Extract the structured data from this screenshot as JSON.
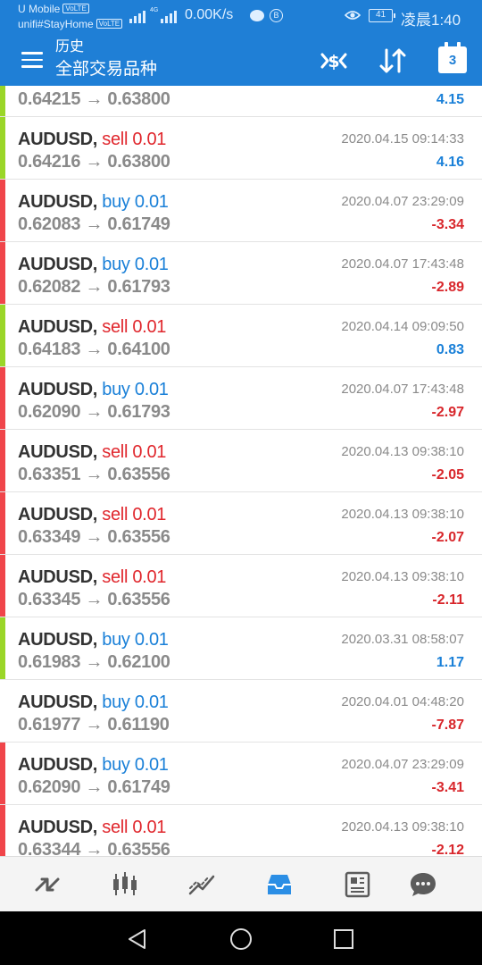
{
  "status_bar": {
    "carrier_1": "U Mobile",
    "carrier_2": "unifi#StayHome",
    "volte_badge": "VoLTE",
    "network_type": "4G",
    "net_speed": "0.00K/s",
    "battery_level": "41",
    "time": "凌晨1:40",
    "icons": [
      "signal-icon",
      "chat-bubble-icon",
      "b-badge-icon",
      "eye-icon",
      "battery-icon"
    ]
  },
  "app_bar": {
    "title": "历史",
    "subtitle": "全部交易品种",
    "calendar_day": "3",
    "icons": [
      "menu-icon",
      "currency-icon",
      "sort-icon",
      "calendar-icon"
    ]
  },
  "deals": [
    {
      "symbol": "",
      "type": "",
      "volume": "",
      "open": "0.64215",
      "close": "0.63800",
      "time": "",
      "profit": "4.15",
      "profit_sign": "pos",
      "marker": "up"
    },
    {
      "symbol": "AUDUSD,",
      "type": "sell",
      "volume": "0.01",
      "open": "0.64216",
      "close": "0.63800",
      "time": "2020.04.15 09:14:33",
      "profit": "4.16",
      "profit_sign": "pos",
      "marker": "up"
    },
    {
      "symbol": "AUDUSD,",
      "type": "buy",
      "volume": "0.01",
      "open": "0.62083",
      "close": "0.61749",
      "time": "2020.04.07 23:29:09",
      "profit": "-3.34",
      "profit_sign": "neg",
      "marker": "down"
    },
    {
      "symbol": "AUDUSD,",
      "type": "buy",
      "volume": "0.01",
      "open": "0.62082",
      "close": "0.61793",
      "time": "2020.04.07 17:43:48",
      "profit": "-2.89",
      "profit_sign": "neg",
      "marker": "down"
    },
    {
      "symbol": "AUDUSD,",
      "type": "sell",
      "volume": "0.01",
      "open": "0.64183",
      "close": "0.64100",
      "time": "2020.04.14 09:09:50",
      "profit": "0.83",
      "profit_sign": "pos",
      "marker": "up"
    },
    {
      "symbol": "AUDUSD,",
      "type": "buy",
      "volume": "0.01",
      "open": "0.62090",
      "close": "0.61793",
      "time": "2020.04.07 17:43:48",
      "profit": "-2.97",
      "profit_sign": "neg",
      "marker": "down"
    },
    {
      "symbol": "AUDUSD,",
      "type": "sell",
      "volume": "0.01",
      "open": "0.63351",
      "close": "0.63556",
      "time": "2020.04.13 09:38:10",
      "profit": "-2.05",
      "profit_sign": "neg",
      "marker": "down"
    },
    {
      "symbol": "AUDUSD,",
      "type": "sell",
      "volume": "0.01",
      "open": "0.63349",
      "close": "0.63556",
      "time": "2020.04.13 09:38:10",
      "profit": "-2.07",
      "profit_sign": "neg",
      "marker": "down"
    },
    {
      "symbol": "AUDUSD,",
      "type": "sell",
      "volume": "0.01",
      "open": "0.63345",
      "close": "0.63556",
      "time": "2020.04.13 09:38:10",
      "profit": "-2.11",
      "profit_sign": "neg",
      "marker": "down"
    },
    {
      "symbol": "AUDUSD,",
      "type": "buy",
      "volume": "0.01",
      "open": "0.61983",
      "close": "0.62100",
      "time": "2020.03.31 08:58:07",
      "profit": "1.17",
      "profit_sign": "pos",
      "marker": "up"
    },
    {
      "symbol": "AUDUSD,",
      "type": "buy",
      "volume": "0.01",
      "open": "0.61977",
      "close": "0.61190",
      "time": "2020.04.01 04:48:20",
      "profit": "-7.87",
      "profit_sign": "neg",
      "marker": "none"
    },
    {
      "symbol": "AUDUSD,",
      "type": "buy",
      "volume": "0.01",
      "open": "0.62090",
      "close": "0.61749",
      "time": "2020.04.07 23:29:09",
      "profit": "-3.41",
      "profit_sign": "neg",
      "marker": "down"
    },
    {
      "symbol": "AUDUSD,",
      "type": "sell",
      "volume": "0.01",
      "open": "0.63344",
      "close": "0.63556",
      "time": "2020.04.13 09:38:10",
      "profit": "-2.12",
      "profit_sign": "neg",
      "marker": "down"
    }
  ],
  "tab_bar": {
    "tabs": [
      "quotes-tab-icon",
      "chart-tab-icon",
      "trade-tab-icon",
      "history-tab-icon",
      "news-tab-icon",
      "messages-tab-icon"
    ],
    "active": "history-tab-icon"
  },
  "system_nav": {
    "buttons": [
      "back-icon",
      "home-icon",
      "recents-icon"
    ]
  },
  "colors": {
    "brand": "#1f7fd6",
    "buy": "#1a80d8",
    "sell": "#e0272d",
    "profit_positive": "#1a80d8",
    "profit_negative": "#d8262b",
    "marker_up": "#9ad628",
    "marker_down": "#f0454a",
    "tab_active": "#2b8ee5",
    "tab_inactive": "#5b5b5b"
  }
}
